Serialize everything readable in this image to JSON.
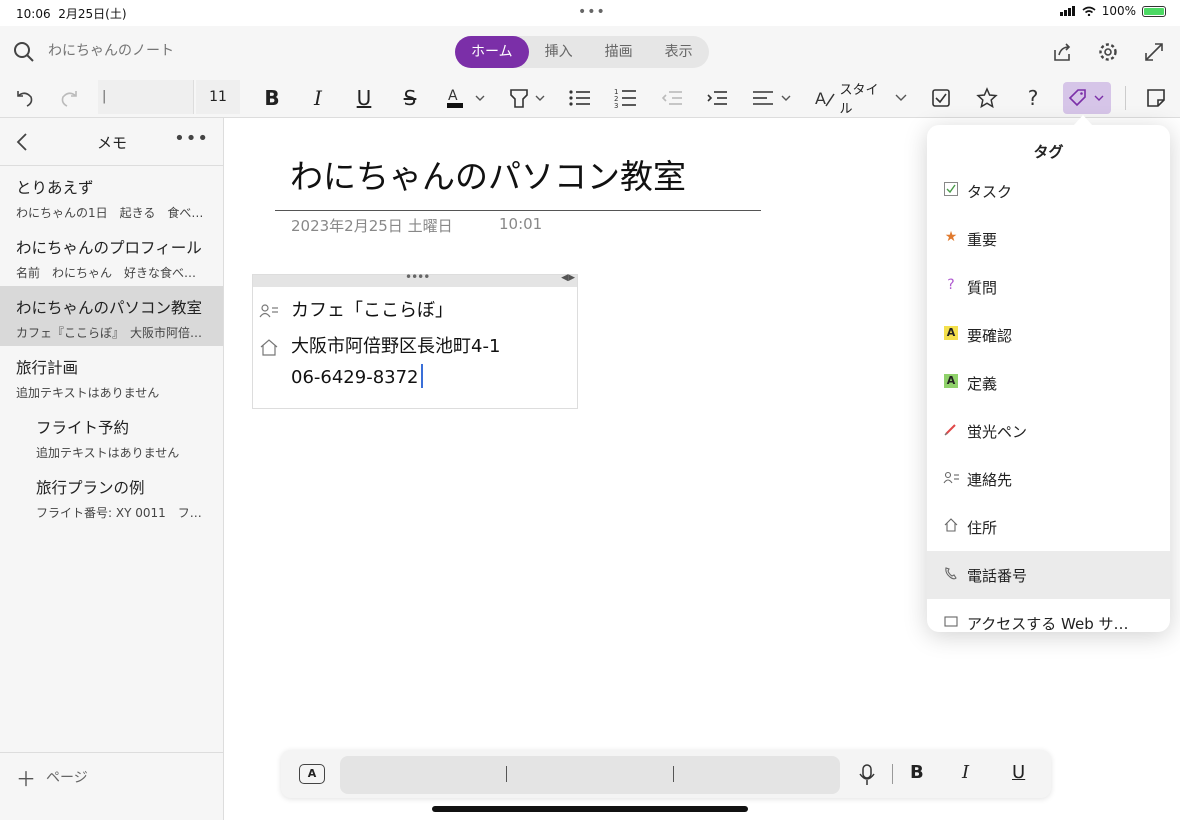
{
  "status": {
    "time": "10:06",
    "date": "2月25日(土)",
    "battery": "100%"
  },
  "topbar": {
    "search_placeholder": "わにちゃんのノート",
    "tabs": [
      {
        "label": "ホーム",
        "active": true
      },
      {
        "label": "挿入",
        "active": false
      },
      {
        "label": "描画",
        "active": false
      },
      {
        "label": "表示",
        "active": false
      }
    ]
  },
  "ribbon": {
    "font_size": "11",
    "style_label": "スタイル"
  },
  "sidebar": {
    "title": "メモ",
    "pages": [
      {
        "title": "とりあえず",
        "preview": "わにちゃんの1日　起きる　食べる…"
      },
      {
        "title": "わにちゃんのプロフィール",
        "preview": "名前　わにちゃん　好きな食べ物…"
      },
      {
        "title": "わにちゃんのパソコン教室",
        "preview": "カフェ『ここらぼ』　大阪市阿倍…"
      },
      {
        "title": "旅行計画",
        "preview": "追加テキストはありません"
      },
      {
        "title": "フライト予約",
        "preview": "追加テキストはありません"
      },
      {
        "title": "旅行プランの例",
        "preview": "フライト番号: XY 0011　フ…"
      }
    ],
    "add_page_label": "ページ"
  },
  "page": {
    "title": "わにちゃんのパソコン教室",
    "date": "2023年2月25日 土曜日",
    "time": "10:01",
    "lines": [
      "カフェ「ここらぼ」",
      "大阪市阿倍野区長池町4-1",
      "06-6429-8372"
    ]
  },
  "tag_menu": {
    "title": "タグ",
    "items": [
      {
        "label": "タスク",
        "icon": "checkbox-icon"
      },
      {
        "label": "重要",
        "icon": "star-icon",
        "color": "#e07a2e"
      },
      {
        "label": "質問",
        "icon": "question-icon",
        "color": "#b05bd0"
      },
      {
        "label": "要確認",
        "icon": "highlight-yellow-icon",
        "color": "#f4e04d"
      },
      {
        "label": "定義",
        "icon": "highlight-green-icon",
        "color": "#8fd16a"
      },
      {
        "label": "蛍光ペン",
        "icon": "pen-icon",
        "color": "#e04848"
      },
      {
        "label": "連絡先",
        "icon": "contact-icon"
      },
      {
        "label": "住所",
        "icon": "home-icon"
      },
      {
        "label": "電話番号",
        "icon": "phone-icon",
        "selected": true
      },
      {
        "label": "アクセスする Web サ…",
        "icon": "web-icon"
      }
    ]
  },
  "colors": {
    "accent": "#7b2fa8",
    "tag_button": "#d6c5e8"
  }
}
